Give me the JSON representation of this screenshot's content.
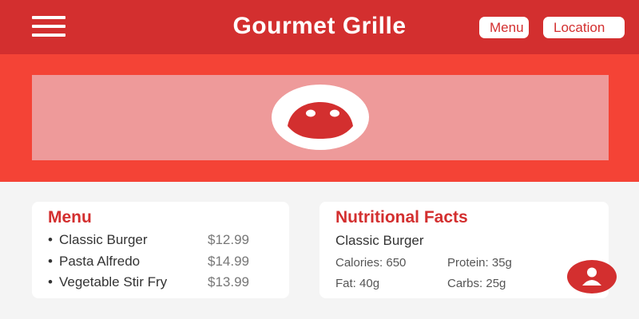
{
  "header": {
    "title": "Gourmet Grille",
    "menu_icon": "hamburger-menu-icon",
    "nav": {
      "menu_label": "Menu",
      "location_label": "Location"
    }
  },
  "banner": {
    "logo_icon": "restaurant-logo-icon"
  },
  "menu_card": {
    "title": "Menu",
    "items": [
      {
        "bullet": "•",
        "name": "Classic Burger",
        "price": "$12.99"
      },
      {
        "bullet": "•",
        "name": "Pasta Alfredo",
        "price": "$14.99"
      },
      {
        "bullet": "•",
        "name": "Vegetable Stir Fry",
        "price": "$13.99"
      }
    ]
  },
  "nutrition_card": {
    "title": "Nutritional Facts",
    "item_name": "Classic Burger",
    "calories": "Calories: 650",
    "protein": "Protein: 35g",
    "fat": "Fat: 40g",
    "carbs": "Carbs: 25g"
  },
  "fab": {
    "icon": "user-profile-icon"
  },
  "colors": {
    "header": "#d32f2f",
    "banner": "#f44336",
    "banner_inner": "#ee9a9a",
    "accent": "#d32f2f",
    "background": "#f4f4f4"
  }
}
